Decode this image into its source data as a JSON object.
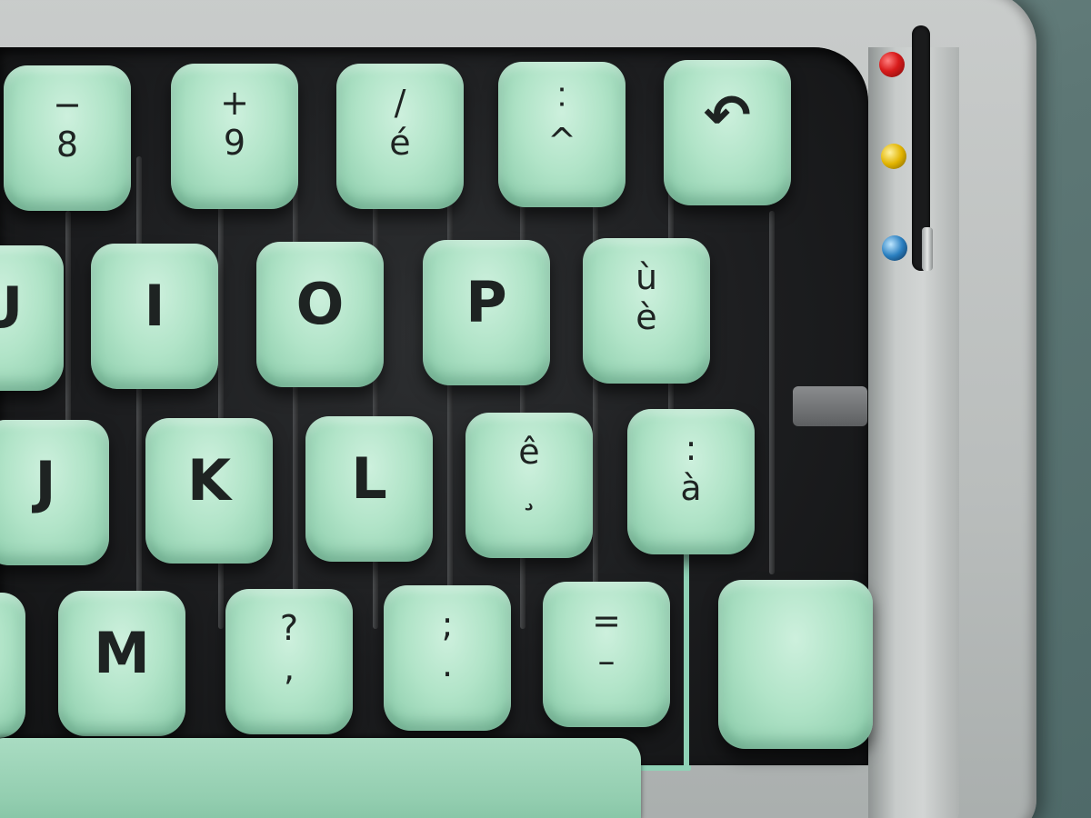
{
  "keyboard": {
    "row1": [
      {
        "id": "eight",
        "top": "−",
        "bottom": "8"
      },
      {
        "id": "nine",
        "top": "+",
        "bottom": "9"
      },
      {
        "id": "slash-e",
        "top": "/",
        "bottom": "é"
      },
      {
        "id": "colon-caret",
        "top": "˸",
        "bottom": "^"
      },
      {
        "id": "backspace",
        "symbol": "↶"
      }
    ],
    "row2": [
      {
        "id": "u",
        "label": "U"
      },
      {
        "id": "i",
        "label": "I"
      },
      {
        "id": "o",
        "label": "O"
      },
      {
        "id": "p",
        "label": "P"
      },
      {
        "id": "u-grave",
        "top": "ù",
        "bottom": "è"
      }
    ],
    "row3": [
      {
        "id": "j",
        "label": "J"
      },
      {
        "id": "k",
        "label": "K"
      },
      {
        "id": "l",
        "label": "L"
      },
      {
        "id": "e-circumflex",
        "top": "ê",
        "bottom": "¸"
      },
      {
        "id": "a-grave",
        "top": ":",
        "bottom": "à"
      }
    ],
    "row4": [
      {
        "id": "n",
        "label": ""
      },
      {
        "id": "m",
        "label": "M"
      },
      {
        "id": "question",
        "top": "?",
        "bottom": ","
      },
      {
        "id": "semicolon",
        "top": ";",
        "bottom": "."
      },
      {
        "id": "equals",
        "top": "=",
        "bottom": "–"
      },
      {
        "id": "blank",
        "label": ""
      }
    ]
  },
  "colors": {
    "key": "#b1e4c8",
    "frame": "#c9cccb",
    "well": "#1c1d1f",
    "pin_red": "#d81b1b",
    "pin_yellow": "#e2b400",
    "pin_blue": "#2a7fc0"
  }
}
